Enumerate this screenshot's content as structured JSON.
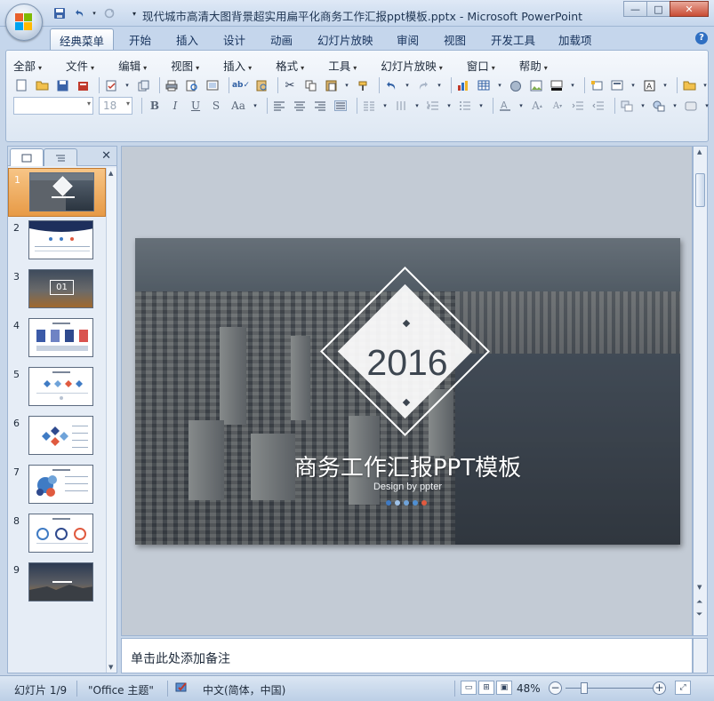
{
  "window": {
    "title": "现代城市高清大图背景超实用扁平化商务工作汇报ppt模板.pptx - Microsoft PowerPoint",
    "minimize": "—",
    "maximize": "□",
    "close": "✕"
  },
  "ribbon_tabs": [
    "经典菜单",
    "开始",
    "插入",
    "设计",
    "动画",
    "幻灯片放映",
    "审阅",
    "视图",
    "开发工具",
    "加载项"
  ],
  "menus": [
    "全部",
    "文件",
    "编辑",
    "视图",
    "插入",
    "格式",
    "工具",
    "幻灯片放映",
    "窗口",
    "帮助"
  ],
  "format": {
    "font_name": "",
    "font_size": "18",
    "bold": "B",
    "italic": "I",
    "underline": "U",
    "shadow": "S",
    "case": "Aa"
  },
  "panel": {
    "slide_count": 9,
    "selected": 1,
    "thumbs": [
      "1",
      "2",
      "3",
      "4",
      "5",
      "6",
      "7",
      "8",
      "9"
    ]
  },
  "slide": {
    "year": "2016",
    "title": "商务工作汇报PPT模板",
    "subtitle": "Design by ppter",
    "dots": [
      "#3f7bc4",
      "#9fc2e8",
      "#6fa3d9",
      "#4f8fd2",
      "#e05a3f"
    ]
  },
  "thumb3_label": "01",
  "notes": {
    "placeholder": "单击此处添加备注"
  },
  "status": {
    "slide_info": "幻灯片 1/9",
    "theme": "\"Office 主题\"",
    "language": "中文(简体，中国)",
    "zoom": "48%",
    "zoom_value": 0.48
  },
  "colors": {
    "ribbon_bg": "#c5d6ec",
    "selected_thumb": "#e79a46"
  }
}
